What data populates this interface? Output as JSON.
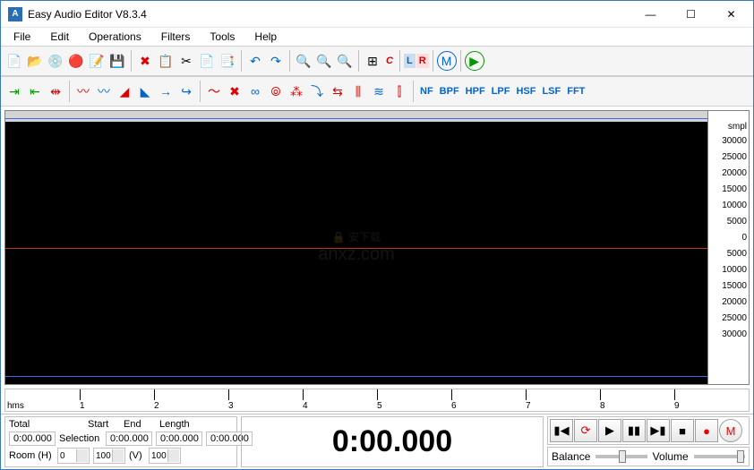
{
  "window": {
    "title": "Easy Audio Editor V8.3.4"
  },
  "menu": {
    "items": [
      "File",
      "Edit",
      "Operations",
      "Filters",
      "Tools",
      "Help"
    ]
  },
  "toolbar1": {
    "new": "📄",
    "open": "📂",
    "cd": "💿",
    "rec": "🔴",
    "edit": "📝",
    "save": "💾",
    "del": "✖",
    "copy": "📋",
    "cut": "✂",
    "paste": "📄",
    "pasteAdd": "📑",
    "undo": "↶",
    "redo": "↷",
    "zoomIn": "🔍",
    "zoomOut": "🔍",
    "zoomSel": "🔍",
    "chan": "⊞",
    "c": "C",
    "l": "L",
    "r": "R",
    "m": "M",
    "go": "▶"
  },
  "toolbar2": {
    "filters": [
      "NF",
      "BPF",
      "HPF",
      "LPF",
      "HSF",
      "LSF",
      "FFT"
    ]
  },
  "scale": {
    "unit": "smpl",
    "ticks": [
      "30000",
      "25000",
      "20000",
      "15000",
      "10000",
      "5000",
      "0",
      "5000",
      "10000",
      "15000",
      "20000",
      "25000",
      "30000"
    ]
  },
  "ruler": {
    "unit": "hms",
    "marks": [
      "1",
      "2",
      "3",
      "4",
      "5",
      "6",
      "7",
      "8",
      "9"
    ]
  },
  "status": {
    "totalLbl": "Total",
    "totalVal": "0:00.000",
    "selLbl": "Selection",
    "startLbl": "Start",
    "startVal": "0:00.000",
    "endLbl": "End",
    "endVal": "0:00.000",
    "lenLbl": "Length",
    "lenVal": "0:00.000",
    "roomLbl": "Room (H)",
    "h1": "0",
    "h2": "100",
    "vLbl": "(V)",
    "v1": "100"
  },
  "time": "0:00.000",
  "transport": {
    "balLbl": "Balance",
    "volLbl": "Volume"
  },
  "watermark": {
    "l1": "安下载",
    "l2": "anxz.com"
  }
}
